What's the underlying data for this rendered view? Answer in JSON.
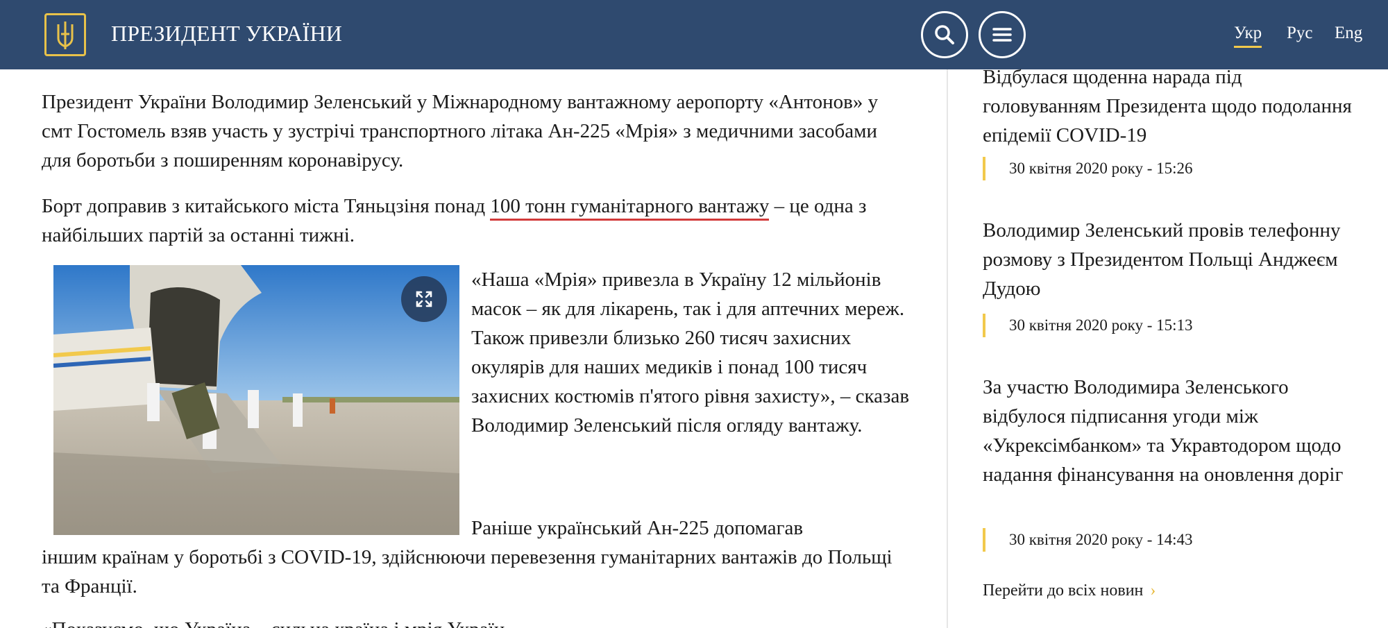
{
  "header": {
    "site_title": "ПРЕЗИДЕНТ УКРАЇНИ",
    "logo_icon": "trident-emblem-icon",
    "search_icon": "search-icon",
    "menu_icon": "hamburger-menu-icon",
    "languages": [
      "Укр",
      "Рус",
      "Eng"
    ],
    "active_language": "Укр",
    "colors": {
      "header_bg": "#2f4a6f",
      "accent": "#f2c94c"
    }
  },
  "article": {
    "p1": "Президент України Володимир Зеленський у Міжнародному вантажному аеропорту «Антонов» у смт Гостомель взяв участь у зустрічі транспортного літака Ан-225 «Мрія» з медичними засобами для боротьби з поширенням коронавірусу.",
    "p2_before": "Борт доправив з китайського міста Тяньцзіня понад ",
    "p2_highlight": "100 тонн гуманітарного вантажу",
    "p2_after": " – це одна з найбільших партій за останні тижні.",
    "photo_expand_icon": "expand-icon",
    "p3": "«Наша «Мрія» привезла в Україну 12 мільйонів масок – як для лікарень, так і для аптечних мереж. Також привезли близько 260 тисяч захисних окулярів для наших медиків і понад 100 тисяч захисних костюмів п'ятого рівня захисту», – сказав Володимир Зеленський після огляду вантажу.",
    "p4_line1": "Раніше український Ан-225 допомагав",
    "p4_rest": "іншим країнам у боротьбі з COVID-19, здійснюючи перевезення гуманітарних вантажів до Польщі та Франції.",
    "p5": "«Показуємо, що Україна – сильна країна і мрія Україн-",
    "highlight_color": "#d23a3a"
  },
  "sidebar": {
    "news": [
      {
        "title": "Відбулася щоденна нарада під головуванням Президента щодо подолання епідемії COVID-19",
        "date": "30 квітня 2020 року - 15:26"
      },
      {
        "title": "Володимир Зеленський провів телефонну розмову з Президентом Польщі Анджеєм Дудою",
        "date": "30 квітня 2020 року - 15:13"
      },
      {
        "title": "За участю Володимира Зеленського відбулося підписання угоди між «Укрексімбанком» та Укравтодором щодо надання фінансування на оновлення доріг",
        "date": "30 квітня 2020 року - 14:43"
      }
    ],
    "all_news_label": "Перейти до всіх новин",
    "all_news_icon": "chevron-right-icon"
  }
}
